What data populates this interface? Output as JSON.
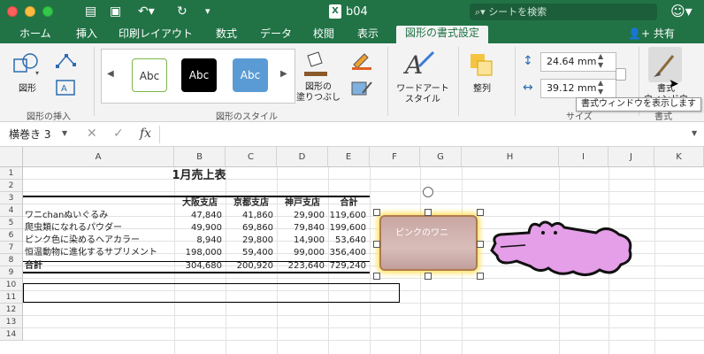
{
  "window": {
    "title": "b04",
    "search_placeholder": "シートを検索"
  },
  "quick_access": {
    "sidebar_icon": "sidebar-icon",
    "save_icon": "save-icon",
    "undo_icon": "undo-icon",
    "redo_icon": "redo-icon"
  },
  "tabs": [
    "ホーム",
    "挿入",
    "印刷レイアウト",
    "数式",
    "データ",
    "校閲",
    "表示",
    "図形の書式設定"
  ],
  "active_tab": "図形の書式設定",
  "share_label": "共有",
  "ribbon": {
    "insert_shapes": {
      "shape_label": "図形",
      "group_label": "図形の挿入"
    },
    "styles": {
      "gallery": [
        "Abc",
        "Abc",
        "Abc"
      ],
      "fill_label": "図形の\n塗りつぶし",
      "group_label": "図形のスタイル"
    },
    "wordart": {
      "label": "ワードアート\nスタイル"
    },
    "arrange": {
      "label": "整列"
    },
    "size": {
      "height": "24.64 mm",
      "width": "39.12 mm",
      "group_label": "サイズ"
    },
    "format_pane": {
      "label": "書式\nウィンドウ",
      "group_label": "書式"
    },
    "tooltip": "書式ウィンドウを表示します"
  },
  "formula_bar": {
    "name_box": "横巻き 3",
    "fx": "fx"
  },
  "columns": [
    "A",
    "B",
    "C",
    "D",
    "E",
    "F",
    "G",
    "H",
    "I",
    "J",
    "K"
  ],
  "rows": [
    "1",
    "2",
    "3",
    "4",
    "5",
    "6",
    "7",
    "8",
    "9",
    "10",
    "11",
    "12",
    "13",
    "14"
  ],
  "sheet": {
    "title": "1月売上表",
    "headers": [
      "大阪支店",
      "京都支店",
      "神戸支店",
      "合計"
    ],
    "items": [
      {
        "name": "ワニchanぬいぐるみ",
        "values": [
          "47,840",
          "41,860",
          "29,900",
          "119,600"
        ]
      },
      {
        "name": "爬虫類になれるパウダー",
        "values": [
          "49,900",
          "69,860",
          "79,840",
          "199,600"
        ]
      },
      {
        "name": "ピンク色に染めるヘアカラー",
        "values": [
          "8,940",
          "29,800",
          "14,900",
          "53,640"
        ]
      },
      {
        "name": "恒温動物に進化するサプリメント",
        "values": [
          "198,000",
          "59,400",
          "99,000",
          "356,400"
        ]
      }
    ],
    "total": {
      "name": "合計",
      "values": [
        "304,680",
        "200,920",
        "223,640",
        "729,240"
      ]
    }
  },
  "shape": {
    "text": "ピンクのワニ"
  }
}
